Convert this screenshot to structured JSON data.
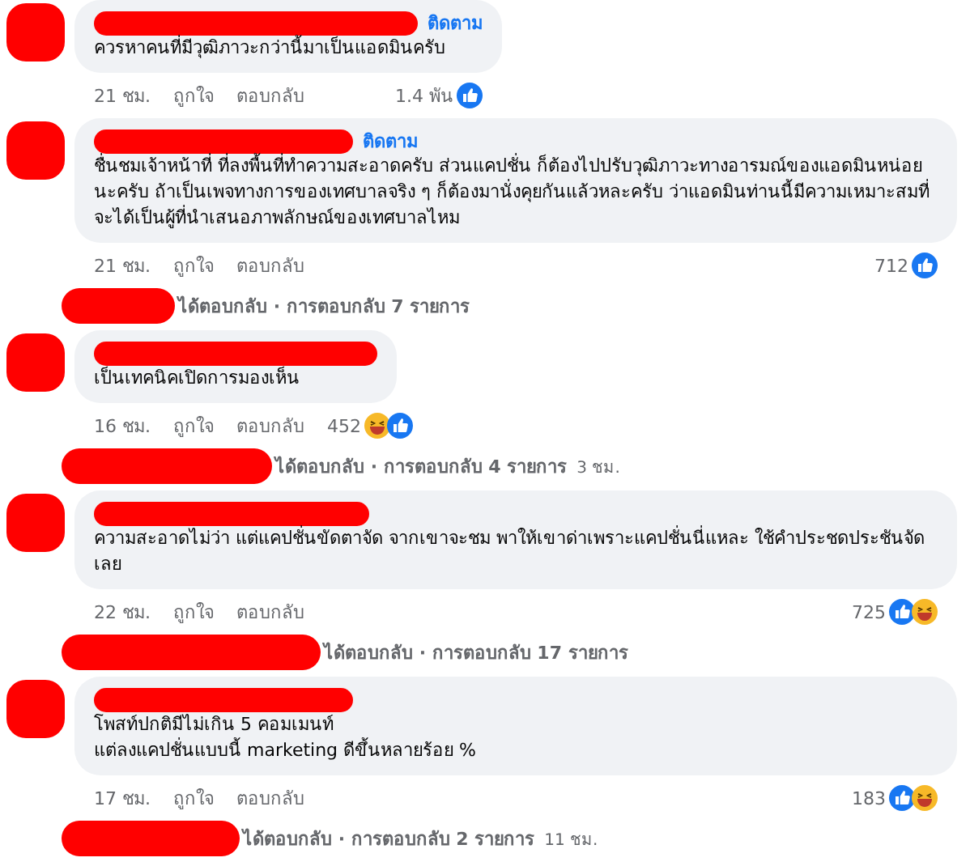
{
  "comments": [
    {
      "follow": "ติดตาม",
      "text": "ควรหาคนที่มีวุฒิภาวะกว่านี้มาเป็นแอดมินครับ",
      "time": "21 ชม.",
      "like": "ถูกใจ",
      "reply": "ตอบกลับ",
      "count": "1.4 พัน",
      "reactions": [
        {
          "kind": "like"
        }
      ]
    },
    {
      "follow": "ติดตาม",
      "text": "ชื่นชมเจ้าหน้าที่ ที่ลงพื้นที่ทำความสะอาดครับ ส่วนแคปชั่น ก็ต้องไปปรับวุฒิภาวะทางอารมณ์ของแอดมินหน่อยนะครับ ถ้าเป็นเพจทางการของเทศบาลจริง ๆ ก็ต้องมานั่งคุยกันแล้วหละครับ ว่าแอดมินท่านนี้มีความเหมาะสมที่จะได้เป็นผู้ที่นำเสนอภาพลักษณ์ของเทศบาลไหม",
      "time": "21 ชม.",
      "like": "ถูกใจ",
      "reply": "ตอบกลับ",
      "count": "712",
      "reactions": [
        {
          "kind": "like"
        }
      ],
      "replies": {
        "text": "ได้ตอบกลับ · การตอบกลับ 7 รายการ"
      }
    },
    {
      "text": "เป็นเทคนิคเปิดการมองเห็น",
      "time": "16 ชม.",
      "like": "ถูกใจ",
      "reply": "ตอบกลับ",
      "count": "452",
      "reactions": [
        {
          "kind": "haha"
        },
        {
          "kind": "like"
        }
      ],
      "replies": {
        "text": "ได้ตอบกลับ · การตอบกลับ 4 รายการ",
        "time": "3 ชม."
      }
    },
    {
      "text": "ความสะอาดไม่ว่า แต่แคปชั่นขัดตาจัด จากเขาจะชม พาให้เขาด่าเพราะแคปชั่นนี่แหละ ใช้คำประชดประชันจัดเลย",
      "time": "22 ชม.",
      "like": "ถูกใจ",
      "reply": "ตอบกลับ",
      "count": "725",
      "reactions": [
        {
          "kind": "like"
        },
        {
          "kind": "haha"
        }
      ],
      "replies": {
        "text": "ได้ตอบกลับ · การตอบกลับ 17 รายการ"
      }
    },
    {
      "text": "โพสท์ปกติมีไม่เกิน 5 คอมเมนท์\nแต่ลงแคปชั่นแบบนี้ marketing ดีขึ้นหลายร้อย %",
      "time": "17 ชม.",
      "like": "ถูกใจ",
      "reply": "ตอบกลับ",
      "count": "183",
      "reactions": [
        {
          "kind": "like"
        },
        {
          "kind": "haha"
        }
      ],
      "replies": {
        "text": "ได้ตอบกลับ · การตอบกลับ 2 รายการ",
        "time": "11 ชม."
      }
    }
  ]
}
